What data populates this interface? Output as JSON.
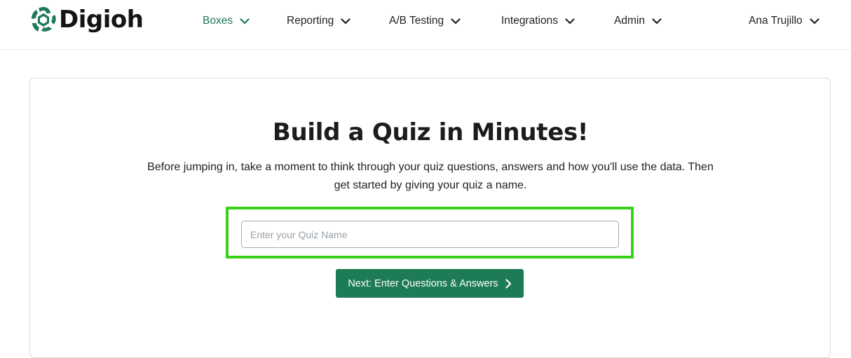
{
  "app": {
    "logo_text": "Digioh",
    "brand_color": "#1e7a57",
    "logo_icon": "digioh-swirl-icon"
  },
  "nav": {
    "items": [
      {
        "label": "Boxes",
        "active": true,
        "icon": "chevron-down-icon"
      },
      {
        "label": "Reporting",
        "active": false,
        "icon": "chevron-down-icon"
      },
      {
        "label": "A/B Testing",
        "active": false,
        "icon": "chevron-down-icon"
      },
      {
        "label": "Integrations",
        "active": false,
        "icon": "chevron-down-icon"
      },
      {
        "label": "Admin",
        "active": false,
        "icon": "chevron-down-icon"
      }
    ],
    "user": {
      "label": "Ana Trujillo",
      "icon": "chevron-down-icon"
    }
  },
  "main": {
    "title": "Build a Quiz in Minutes!",
    "description": "Before jumping in, take a moment to think through your quiz questions, answers and how you'll use the data. Then get started by giving your quiz a name.",
    "quiz_name_input": {
      "value": "",
      "placeholder": "Enter your Quiz Name"
    },
    "highlight_color": "#3ad219",
    "next_button": {
      "label": "Next: Enter Questions & Answers",
      "icon": "chevron-right-icon",
      "color": "#1d7b55"
    }
  }
}
